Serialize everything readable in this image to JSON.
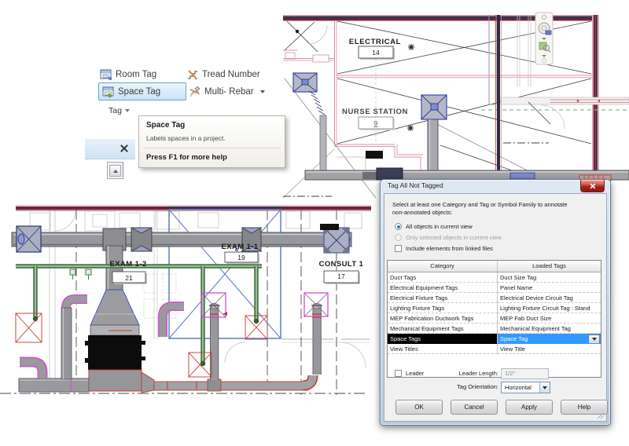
{
  "ribbon": {
    "room_tag": "Room Tag",
    "tread_number": "Tread Number",
    "space_tag": "Space Tag",
    "multi_rebar": "Multi- Rebar",
    "panel_label": "Tag"
  },
  "tooltip": {
    "title": "Space Tag",
    "description": "Labels spaces in a project.",
    "help": "Press F1 for more help"
  },
  "floorplan": {
    "rooms": [
      {
        "name": "ELECTRICAL",
        "number": "14"
      },
      {
        "name": "NURSE STATION",
        "number": "9"
      },
      {
        "name": "EXAM 1-2",
        "number": "21"
      },
      {
        "name": "EXAM 1-1",
        "number": "19"
      },
      {
        "name": "CONSULT 1",
        "number": "17"
      }
    ]
  },
  "dialog": {
    "title": "Tag All Not Tagged",
    "intro_line1": "Select at least one Category and Tag or Symbol Family to annotate",
    "intro_line2": "non-annotated objects:",
    "radio_all": "All objects in current view",
    "radio_selected": "Only selected objects in current view",
    "checkbox_linked": "Include elements from linked files",
    "table": {
      "headers": [
        "Category",
        "Loaded Tags"
      ],
      "rows": [
        [
          "Duct Tags",
          "Duct Size Tag"
        ],
        [
          "Electrical Equipment Tags",
          "Panel Name"
        ],
        [
          "Electrical Fixture Tags",
          "Electrical Device Circuit Tag"
        ],
        [
          "Lighting Fixture Tags",
          "Lighting Fixture Circuit Tag : Stand"
        ],
        [
          "MEP Fabrication Ductwork Tags",
          "MEP Fab Duct Size"
        ],
        [
          "Mechanical Equipment Tags",
          "Mechanical Equipment Tag"
        ],
        [
          "Space Tags",
          "Space Tag"
        ],
        [
          "View Titles",
          "View Title"
        ]
      ]
    },
    "leader_label": "Leader",
    "leader_length_label": "Leader Length:",
    "leader_length_value": "1/2\"",
    "tag_orientation_label": "Tag Orientation:",
    "tag_orientation_value": "Horizontal",
    "buttons": [
      "OK",
      "Cancel",
      "Apply",
      "Help"
    ]
  },
  "colors": {
    "selection_blue": "#3399ff",
    "ribbon_highlight": "#c9e3f6",
    "wall_maroon": "#6d2639",
    "wall_pink": "#d98ca0",
    "duct_gray": "#9a9a9e",
    "pipe_green": "#3f7d3f",
    "highlight_magenta": "#cc55cc",
    "annotation_red": "#c0392b",
    "system_navy": "#3a3350"
  }
}
